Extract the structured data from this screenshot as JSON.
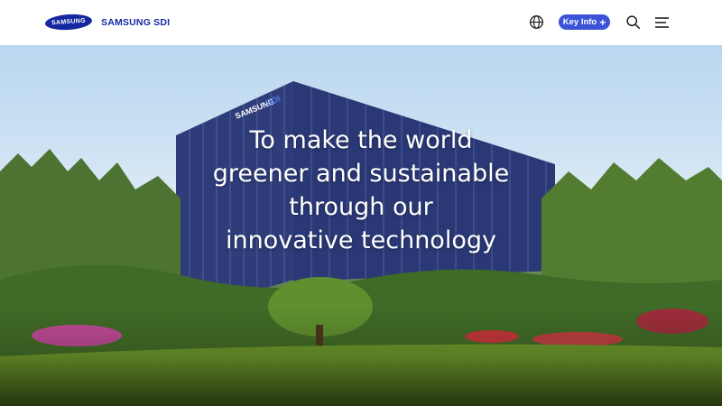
{
  "header": {
    "logo_mark": "SAMSUNG",
    "brand_name": "SAMSUNG SDI",
    "key_info_label": "Key Info",
    "key_info_plus": "+",
    "icons": [
      "globe-icon",
      "search-icon",
      "menu-icon",
      "plus-icon"
    ]
  },
  "hero": {
    "building_sign_1": "SAMSUNG",
    "building_sign_2": "SDI",
    "headline_lines": [
      "To make the world",
      "greener and sustainable",
      "through our",
      "innovative technology"
    ]
  },
  "colors": {
    "brand_blue": "#1428a0",
    "button_blue": "#3b53d9",
    "text_white": "#ffffff"
  }
}
